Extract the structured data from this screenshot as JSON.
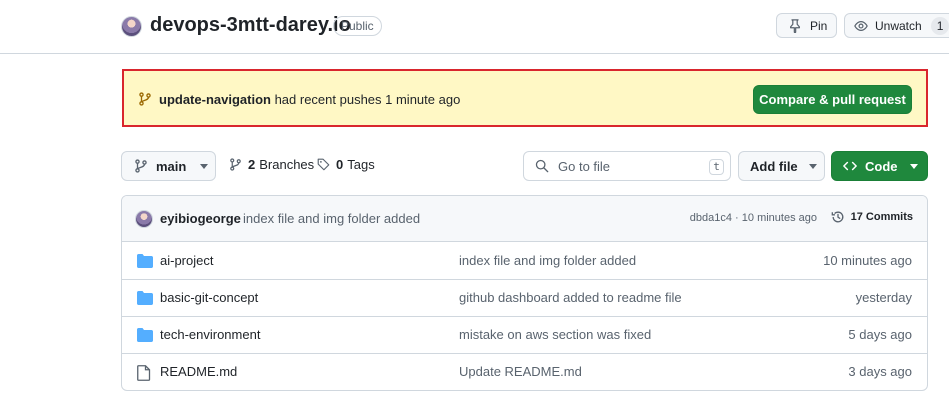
{
  "repo": {
    "name": "devops-3mtt-darey.io",
    "visibility": "Public",
    "pin_label": "Pin",
    "watch_label": "Unwatch",
    "watch_count": "1"
  },
  "banner": {
    "branch": "update-navigation",
    "message": " had recent pushes 1 minute ago",
    "button": "Compare & pull request"
  },
  "toolbar": {
    "branch_button": "main",
    "branches_count": "2",
    "branches_label": "Branches",
    "tags_count": "0",
    "tags_label": "Tags",
    "goto_placeholder": "Go to file",
    "goto_shortcut": "t",
    "add_file_label": "Add file",
    "code_label": "Code"
  },
  "latest_commit": {
    "author": "eyibiogeorge",
    "message": "index file and img folder added",
    "hash_time": "dbda1c4 · 10 minutes ago",
    "commits_label": "17 Commits"
  },
  "files": [
    {
      "type": "folder",
      "name": "ai-project",
      "message": "index file and img folder added",
      "date": "10 minutes ago"
    },
    {
      "type": "folder",
      "name": "basic-git-concept",
      "message": "github dashboard added to readme file",
      "date": "yesterday"
    },
    {
      "type": "folder",
      "name": "tech-environment",
      "message": "mistake on aws section was fixed",
      "date": "5 days ago"
    },
    {
      "type": "file",
      "name": "README.md",
      "message": "Update README.md",
      "date": "3 days ago"
    }
  ],
  "colors": {
    "primary_green": "#1f883d",
    "banner_bg": "#fff8c5",
    "banner_highlight_border": "#d9262d",
    "folder_blue": "#54aeff",
    "muted_text": "#59636e"
  }
}
